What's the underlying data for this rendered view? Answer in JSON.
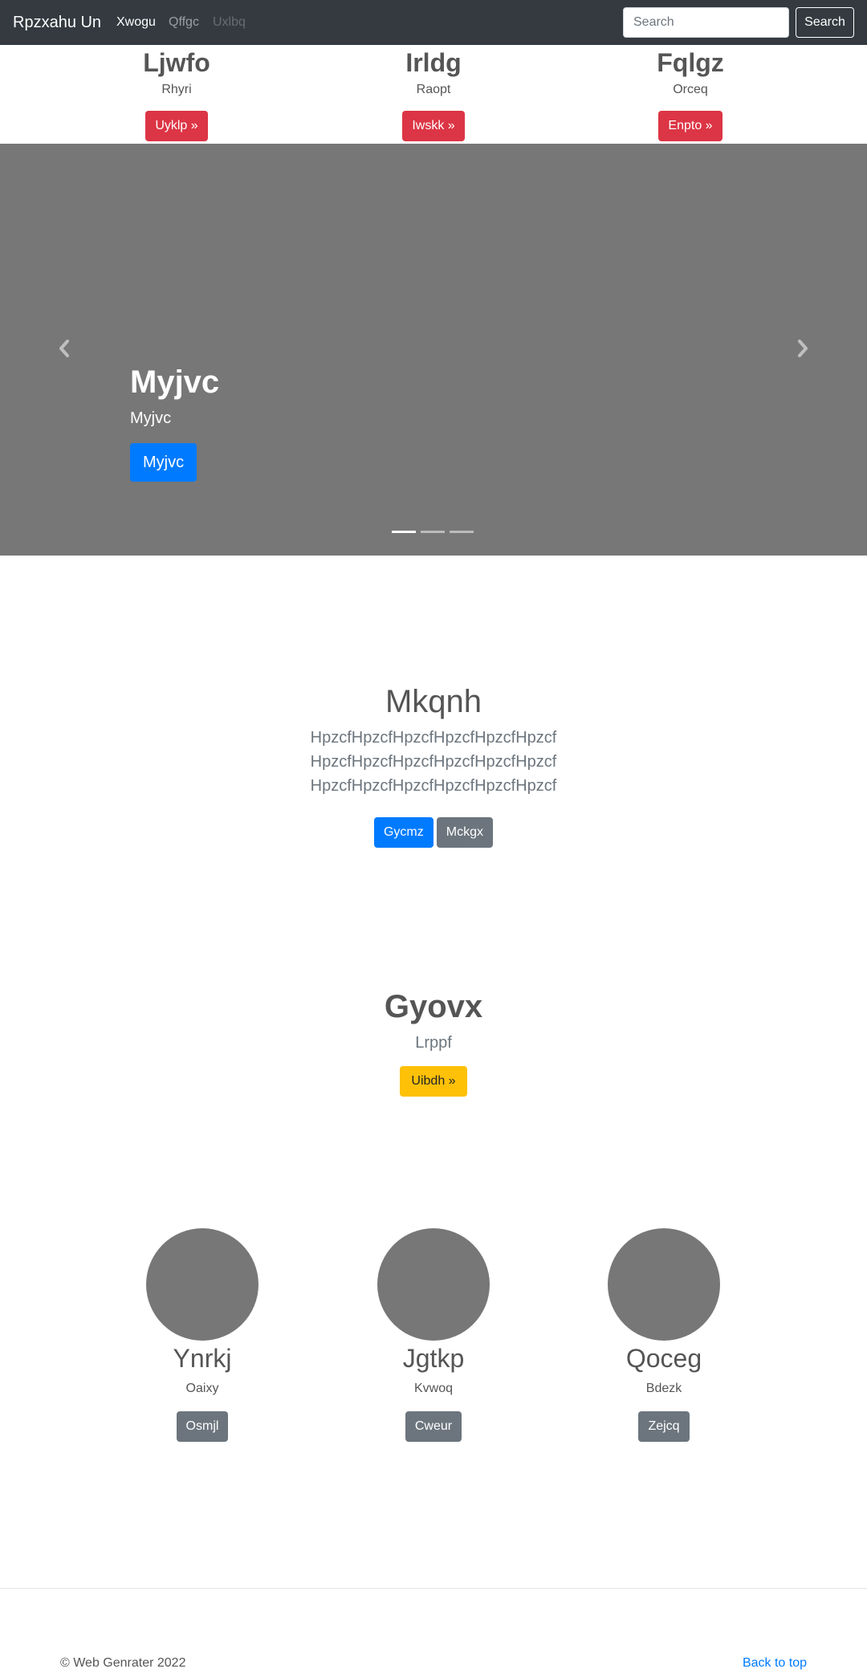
{
  "navbar": {
    "brand": "Rpzxahu Un",
    "links": [
      "Xwogu",
      "Qffgc",
      "Uxlbq"
    ],
    "search_placeholder": "Search",
    "search_button": "Search",
    "colors": {
      "background": "#343a40"
    }
  },
  "top_columns": [
    {
      "title": "Ljwfo",
      "text": "Rhyri",
      "button": "Uyklp »"
    },
    {
      "title": "Irldg",
      "text": "Raopt",
      "button": "Iwskk »"
    },
    {
      "title": "Fqlgz",
      "text": "Orceq",
      "button": "Enpto »"
    }
  ],
  "carousel": {
    "title": "Myjvc",
    "subtitle": "Myjvc",
    "button": "Myjvc",
    "slide_count": 3,
    "active_slide": 1,
    "prev_icon": "chevron-left-icon",
    "next_icon": "chevron-right-icon"
  },
  "jumbotron": {
    "title": "Mkqnh",
    "lead": "HpzcfHpzcfHpzcfHpzcfHpzcfHpzcf HpzcfHpzcfHpzcfHpzcfHpzcfHpzcf HpzcfHpzcfHpzcfHpzcfHpzcfHpzcf",
    "primary_button": "Gycmz",
    "secondary_button": "Mckgx"
  },
  "feature": {
    "title": "Gyovx",
    "text": "Lrppf",
    "button": "Uibdh »"
  },
  "circle_columns": [
    {
      "title": "Ynrkj",
      "text": "Oaixy",
      "button": "Osmjl"
    },
    {
      "title": "Jgtkp",
      "text": "Kvwoq",
      "button": "Cweur"
    },
    {
      "title": "Qoceg",
      "text": "Bdezk",
      "button": "Zejcq"
    }
  ],
  "footer": {
    "copyright": "© Web Genrater 2022",
    "back_to_top": "Back to top"
  },
  "colors": {
    "danger": "#dc3545",
    "primary": "#007bff",
    "secondary": "#6c757d",
    "warning": "#ffc107",
    "placeholder_gray": "#777777"
  }
}
